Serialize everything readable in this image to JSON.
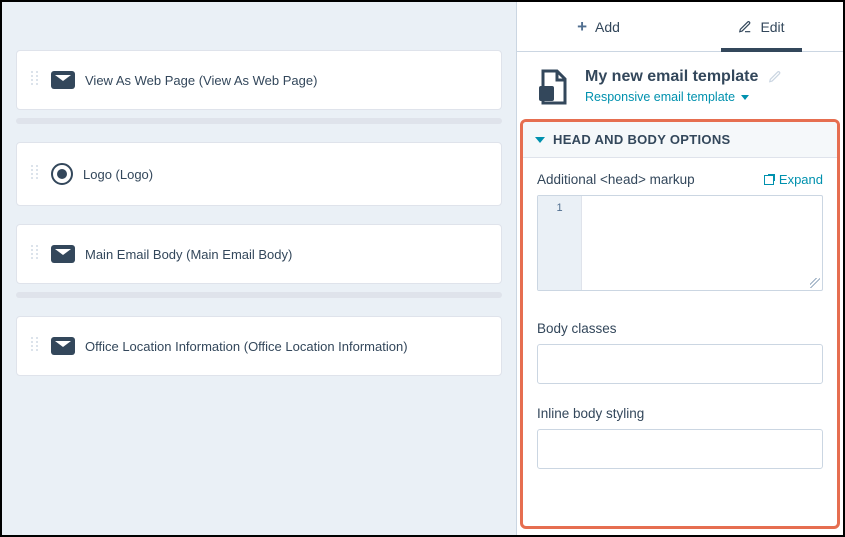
{
  "tabs": {
    "add": "Add",
    "edit": "Edit"
  },
  "template": {
    "title": "My new email template",
    "type": "Responsive email template"
  },
  "blocks": [
    {
      "label": "View As Web Page (View As Web Page)",
      "icon": "envelope"
    },
    {
      "label": "Logo (Logo)",
      "icon": "logo"
    },
    {
      "label": "Main Email Body (Main Email Body)",
      "icon": "envelope"
    },
    {
      "label": "Office Location Information (Office Location Information)",
      "icon": "envelope"
    }
  ],
  "section": {
    "title": "HEAD AND BODY OPTIONS",
    "head_label": "Additional <head> markup",
    "expand": "Expand",
    "line_number": "1",
    "body_classes_label": "Body classes",
    "inline_body_label": "Inline body styling"
  }
}
